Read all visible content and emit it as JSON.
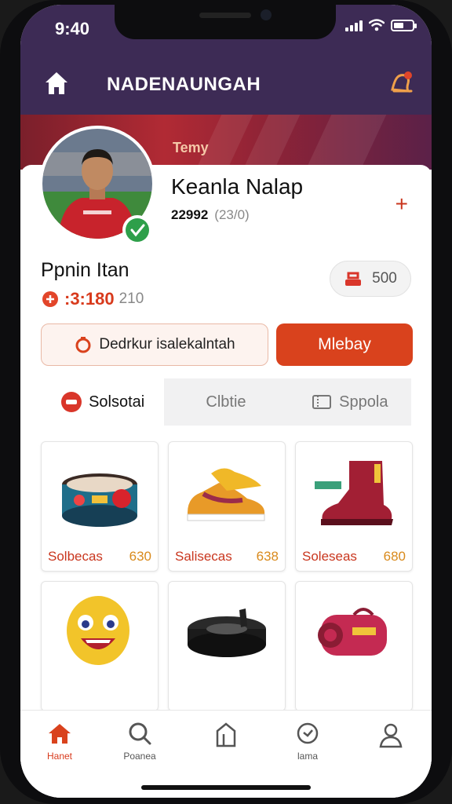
{
  "status_bar": {
    "time": "9:40"
  },
  "header": {
    "title": "NADENAUNGAH",
    "home_icon": "home-icon",
    "notification_icon": "bell-icon"
  },
  "banner": {
    "tag": "Temy"
  },
  "profile": {
    "name": "Keanla Nalap",
    "stat_value": "22992",
    "stat_sub": "(23/0)",
    "add_label": "+",
    "username": "Ppnin Itan",
    "points_value": ":3:180",
    "points_sub": "210",
    "coins": "500"
  },
  "actions": {
    "secondary_label": "Dedrkur isalekalntah",
    "primary_label": "Mlebay"
  },
  "tabs": [
    {
      "label": "Solsotai",
      "active": true
    },
    {
      "label": "Clbtie",
      "active": false
    },
    {
      "label": "Sppola",
      "active": false
    }
  ],
  "products": [
    {
      "label": "Solbecas",
      "price": "630"
    },
    {
      "label": "Salisecas",
      "price": "638"
    },
    {
      "label": "Soleseas",
      "price": "680"
    },
    {
      "label": "",
      "price": ""
    },
    {
      "label": "",
      "price": ""
    },
    {
      "label": "",
      "price": ""
    }
  ],
  "nav": [
    {
      "label": "Hanet",
      "icon": "home-icon",
      "active": true
    },
    {
      "label": "Poanea",
      "icon": "search-icon",
      "active": false
    },
    {
      "label": "",
      "icon": "bag-icon",
      "active": false
    },
    {
      "label": "lama",
      "icon": "clock-icon",
      "active": false
    },
    {
      "label": "",
      "icon": "profile-icon",
      "active": false
    }
  ],
  "colors": {
    "accent": "#d9421d",
    "header_bg": "#3d2b55",
    "price": "#d98a1c"
  }
}
